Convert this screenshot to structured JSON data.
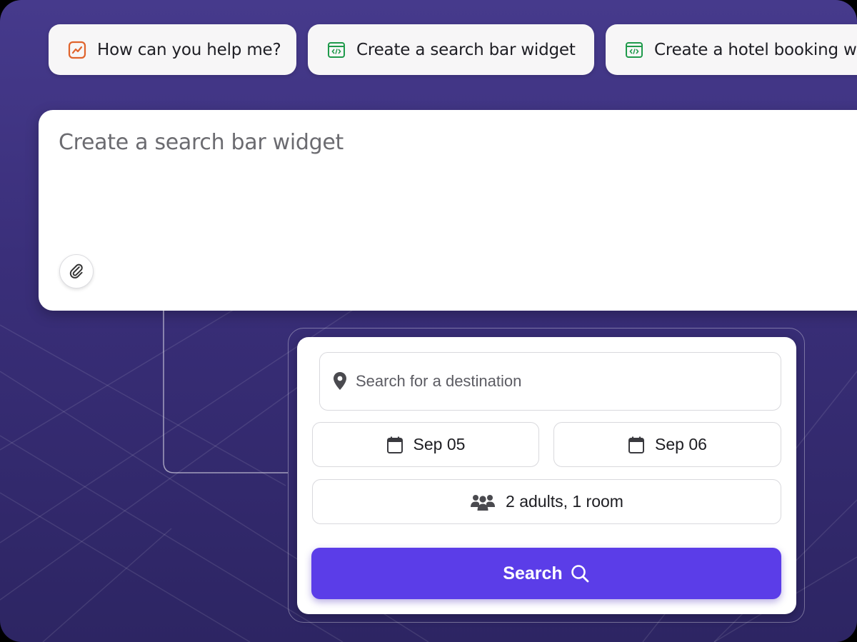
{
  "suggestions": [
    {
      "label": "How can you help me?",
      "icon": "chart-trend-icon",
      "icon_color": "#e0632c"
    },
    {
      "label": "Create a search bar widget",
      "icon": "code-window-icon",
      "icon_color": "#1f9a4b"
    },
    {
      "label": "Create a hotel booking wo",
      "icon": "code-window-icon",
      "icon_color": "#1f9a4b"
    }
  ],
  "prompt": {
    "text": "Create a search bar widget",
    "attach_icon": "paperclip-icon"
  },
  "widget": {
    "destination_placeholder": "Search for a destination",
    "checkin": "Sep 05",
    "checkout": "Sep 06",
    "guests": "2 adults, 1 room",
    "search_label": "Search",
    "accent_color": "#5b3de8"
  }
}
